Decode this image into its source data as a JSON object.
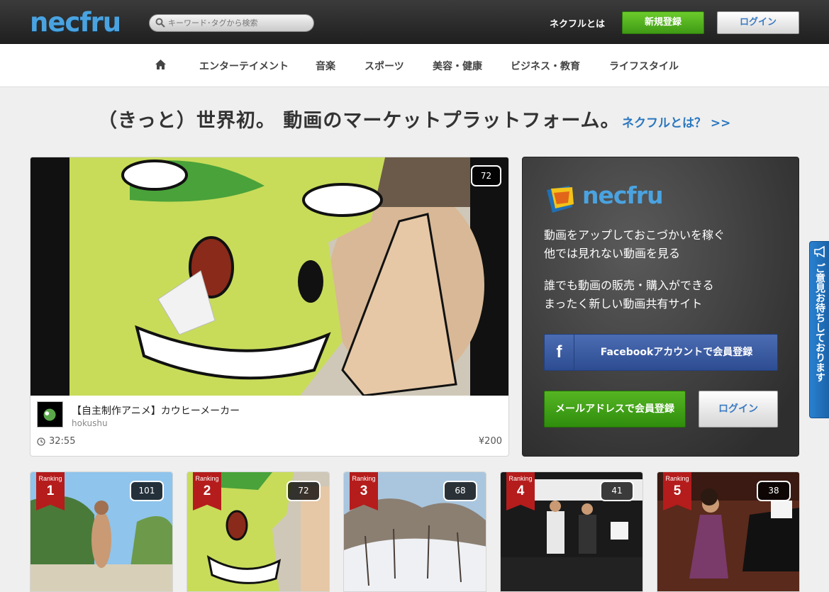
{
  "header": {
    "logo": "necfru",
    "search_placeholder": "キーワード･タグから検索",
    "about_link": "ネクフルとは",
    "register_button": "新規登録",
    "login_button": "ログイン"
  },
  "nav": {
    "items": [
      {
        "label": "エンターテイメント"
      },
      {
        "label": "音楽"
      },
      {
        "label": "スポーツ"
      },
      {
        "label": "美容・健康"
      },
      {
        "label": "ビジネス・教育"
      },
      {
        "label": "ライフスタイル"
      }
    ]
  },
  "headline": {
    "text": "（きっと）世界初。 動画のマーケットプラットフォーム。",
    "link": "ネクフルとは？ >>"
  },
  "featured": {
    "count": "72",
    "title": "【自主制作アニメ】カウヒーメーカー",
    "author": "hokushu",
    "duration": "32:55",
    "price": "¥200"
  },
  "promo": {
    "logo": "necfru",
    "lines": [
      "動画をアップしておこづかいを稼ぐ",
      "他では見れない動画を見る",
      "誰でも動画の販売・購入ができる",
      "まったく新しい動画共有サイト"
    ],
    "facebook_button": "Facebookアカウントで会員登録",
    "facebook_icon_letter": "f",
    "mail_button": "メールアドレスで会員登録",
    "login_button": "ログイン"
  },
  "feedback_tab": {
    "text": "ご意見お待ちしております"
  },
  "ranking": {
    "label": "Ranking",
    "cards": [
      {
        "rank": "1",
        "count": "101"
      },
      {
        "rank": "2",
        "count": "72"
      },
      {
        "rank": "3",
        "count": "68"
      },
      {
        "rank": "4",
        "count": "41"
      },
      {
        "rank": "5",
        "count": "38"
      }
    ]
  },
  "colors": {
    "header_bg": "#2b2b2b",
    "brand_blue": "#4aa3e0",
    "register_green": "#4fae1c",
    "link_blue": "#2a77bf",
    "facebook_blue": "#3b5998",
    "ribbon_red": "#b51c1c",
    "feedback_blue": "#2277c8"
  }
}
